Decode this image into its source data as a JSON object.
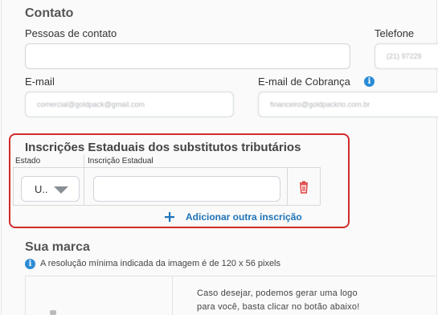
{
  "contato": {
    "title": "Contato",
    "pessoas_label": "Pessoas de contato",
    "pessoas_value": "",
    "telefone_label": "Telefone",
    "telefone_value": "(21) 97229",
    "email_label": "E-mail",
    "email_value": "comercial@goldpack@gmail.com",
    "email_cobranca_label": "E-mail de Cobrança",
    "email_cobranca_value": "financeiro@goldpackrio.com.br",
    "info_icon": "info-icon"
  },
  "inscricoes": {
    "title": "Inscrições Estaduais dos substitutos tributários",
    "col_estado": "Estado",
    "col_inscricao": "Inscrição Estadual",
    "estado_value": "U..",
    "inscricao_value": "",
    "delete_icon": "trash-icon",
    "add_label": "Adicionar outra inscrição",
    "add_icon": "plus-icon",
    "accent_color": "#1e73b8",
    "highlight_color": "#d12b2b"
  },
  "marca": {
    "title": "Sua marca",
    "resolution_note": "A resolução mínima indicada da imagem é de 120 x 56 pixels",
    "hint_line1": "Caso desejar, podemos gerar uma logo",
    "hint_line2": "para você, basta clicar no botão abaixo!"
  }
}
